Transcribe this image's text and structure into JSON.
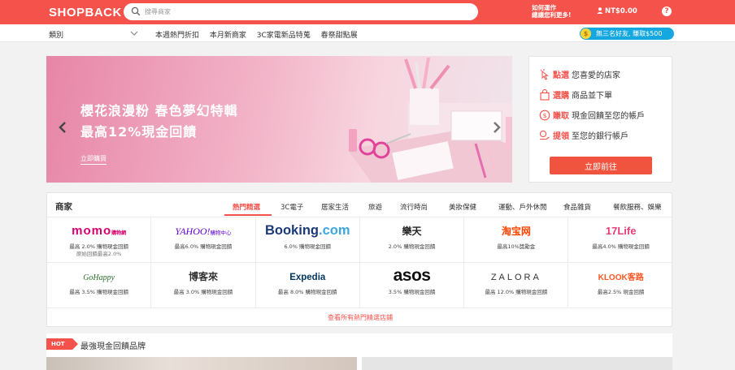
{
  "header": {
    "logo": "SHOPBACK",
    "search_placeholder": "搜尋商家",
    "howto_line1": "如何運作",
    "howto_line2": "總讓您利更多!",
    "balance": "NT$0.00",
    "help": "?"
  },
  "subnav": {
    "category": "類別",
    "links": [
      "本週熱門折扣",
      "本月新商家",
      "3C家電新品特蒐",
      "春祭甜點展"
    ],
    "invite_coin": "$",
    "invite": "無三名好友, 賺取$500"
  },
  "banner": {
    "title": "櫻花浪漫粉 春色夢幻特輯",
    "subtitle": "最高12%現金回饋",
    "cta": "立即購買"
  },
  "steps": {
    "items": [
      {
        "kw": "點選",
        "text": "您喜愛的店家"
      },
      {
        "kw": "選購",
        "text": "商品並下單"
      },
      {
        "kw": "賺取",
        "text": "現金回饋至您的帳戶"
      },
      {
        "kw": "提領",
        "text": "至您的銀行帳戶"
      }
    ],
    "button": "立即前往"
  },
  "merchants": {
    "title": "商家",
    "tabs": [
      "熱門精選",
      "3C電子",
      "居家生活",
      "旅遊",
      "流行時尚",
      "美妝保健",
      "運動、戶外休閒",
      "食品雜貨",
      "餐飲服務、娛樂"
    ],
    "cells": [
      {
        "logo": "momo",
        "logo_sub": "購物網",
        "rate": "最高 2.0% 購物現金回饋",
        "rate2": "原始回饋最高2.0%"
      },
      {
        "logo": "YAHOO!",
        "logo_sub": "購物中心",
        "rate": "最高6.0% 購物現金回饋",
        "rate2": ""
      },
      {
        "logo": "Booking",
        "logo_sub": ".com",
        "rate": "6.0% 購物現金回饋",
        "rate2": ""
      },
      {
        "logo": "樂天",
        "logo_sub": "",
        "rate": "2.0% 購物現金回饋",
        "rate2": ""
      },
      {
        "logo": "淘宝网",
        "logo_sub": "",
        "rate": "最高10%獎勵金",
        "rate2": ""
      },
      {
        "logo": "17Life",
        "logo_sub": "",
        "rate": "最高4.0% 購物現金回饋",
        "rate2": ""
      },
      {
        "logo": "GoHappy",
        "logo_sub": "",
        "rate": "最高 3.5% 購物現金回饋",
        "rate2": ""
      },
      {
        "logo": "博客來",
        "logo_sub": "",
        "rate": "最高 3.0% 購物現金回饋",
        "rate2": ""
      },
      {
        "logo": "Expedia",
        "logo_sub": "",
        "rate": "最高 8.0% 購物現金回饋",
        "rate2": ""
      },
      {
        "logo": "asos",
        "logo_sub": "",
        "rate": "3.5% 購物現金回饋",
        "rate2": ""
      },
      {
        "logo": "ZALORA",
        "logo_sub": "",
        "rate": "最高 12.0% 購物現金回饋",
        "rate2": ""
      },
      {
        "logo": "KLOOK客路",
        "logo_sub": "",
        "rate": "最高2.5% 現金回饋",
        "rate2": ""
      }
    ],
    "view_all": "查看所有熱門精選店鋪"
  },
  "hot": {
    "badge": "HOT",
    "title": "最強現金回饋品牌"
  },
  "colors": {
    "brand": "#f5524b",
    "invite": "#15a7e0",
    "cta": "#f0543f"
  }
}
